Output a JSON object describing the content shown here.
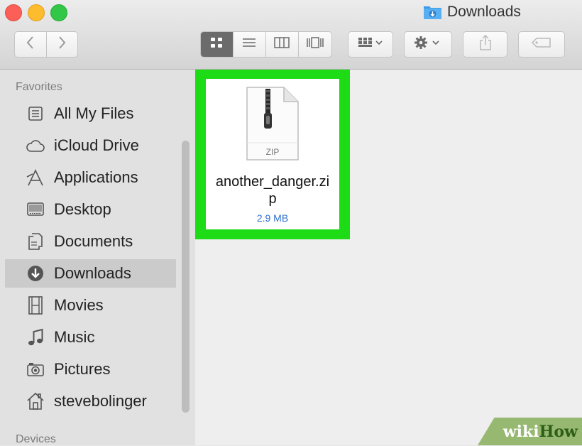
{
  "window": {
    "title": "Downloads"
  },
  "icons": {
    "window_title": "downloads-folder-icon",
    "nav_back": "chevron-left-icon",
    "nav_forward": "chevron-right-icon",
    "view_icon": "icon-view-icon",
    "view_list": "list-view-icon",
    "view_column": "column-view-icon",
    "view_coverflow": "cover-flow-icon",
    "arrange": "arrange-grid-icon",
    "action": "gear-icon",
    "share": "share-icon",
    "tags": "tag-icon"
  },
  "sidebar": {
    "favorites_heading": "Favorites",
    "devices_heading": "Devices",
    "items": [
      {
        "label": "All My Files",
        "icon": "all-files-icon"
      },
      {
        "label": "iCloud Drive",
        "icon": "cloud-icon"
      },
      {
        "label": "Applications",
        "icon": "applications-icon"
      },
      {
        "label": "Desktop",
        "icon": "desktop-icon"
      },
      {
        "label": "Documents",
        "icon": "documents-icon"
      },
      {
        "label": "Downloads",
        "icon": "downloads-icon",
        "selected": true
      },
      {
        "label": "Movies",
        "icon": "film-icon"
      },
      {
        "label": "Music",
        "icon": "music-note-icon"
      },
      {
        "label": "Pictures",
        "icon": "camera-icon"
      },
      {
        "label": "stevebolinger",
        "icon": "home-icon"
      }
    ]
  },
  "file": {
    "type_label": "ZIP",
    "name_line1": "another_danger.zi",
    "name_line2": "p",
    "size": "2.9 MB",
    "icon": "zip-archive-icon"
  },
  "watermark": {
    "part1": "wiki",
    "part2": "How"
  },
  "colors": {
    "highlight": "#1ddc16",
    "selection": "#cbcbcb",
    "file_size": "#2f6fd0",
    "close": "#fc5f57",
    "minimize": "#fdbc2e",
    "zoom": "#33c748"
  }
}
